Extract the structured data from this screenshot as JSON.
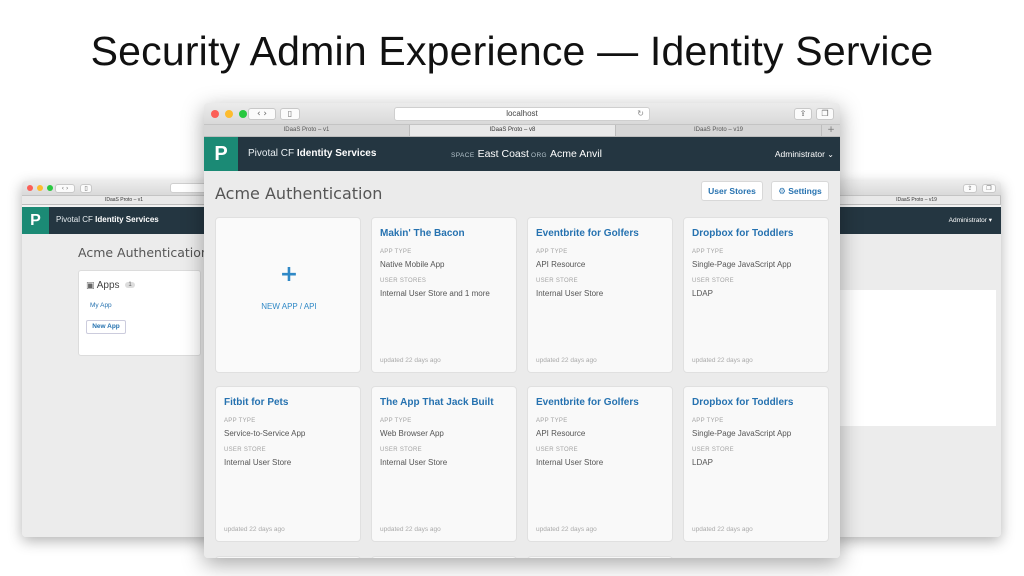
{
  "slide": {
    "title": "Security Admin Experience — Identity Service"
  },
  "browser": {
    "url": "localhost",
    "tabs": [
      "IDaaS Proto – v1",
      "IDaaS Proto – v8",
      "IDaaS Proto – v19"
    ]
  },
  "app": {
    "logo": "P",
    "brand_prefix": "Pivotal CF",
    "brand_name": "Identity Services",
    "space_label": "SPACE",
    "space_value": "East Coast",
    "org_label": "ORG",
    "org_value": "Acme Anvil",
    "user_menu": "Administrator"
  },
  "main": {
    "page_title": "Acme Authentication",
    "user_stores_button": "User Stores",
    "settings_button": "Settings",
    "new_app_label": "NEW APP / API",
    "field_labels": {
      "app_type": "APP TYPE",
      "user_stores": "USER STORES",
      "user_store": "USER STORE"
    },
    "cards": [
      {
        "name": "Makin' The Bacon",
        "app_type": "Native Mobile App",
        "store_label": "USER STORES",
        "store": "Internal User Store and 1 more",
        "updated": "updated 22 days ago"
      },
      {
        "name": "Eventbrite for Golfers",
        "app_type": "API Resource",
        "store_label": "USER STORE",
        "store": "Internal User Store",
        "updated": "updated 22 days ago"
      },
      {
        "name": "Dropbox for Toddlers",
        "app_type": "Single-Page JavaScript App",
        "store_label": "USER STORE",
        "store": "LDAP",
        "updated": "updated 22 days ago"
      },
      {
        "name": "Fitbit for Pets",
        "app_type": "Service-to-Service App",
        "store_label": "USER STORE",
        "store": "Internal User Store",
        "updated": "updated 22 days ago"
      },
      {
        "name": "The App That Jack Built",
        "app_type": "Web Browser App",
        "store_label": "USER STORE",
        "store": "Internal User Store",
        "updated": "updated 22 days ago"
      },
      {
        "name": "Eventbrite for Golfers",
        "app_type": "API Resource",
        "store_label": "USER STORE",
        "store": "Internal User Store",
        "updated": "updated 22 days ago"
      },
      {
        "name": "Dropbox for Toddlers",
        "app_type": "Single-Page JavaScript App",
        "store_label": "USER STORE",
        "store": "LDAP",
        "updated": "updated 22 days ago"
      }
    ]
  },
  "left": {
    "page_title": "Acme Authentication",
    "apps_title": "Apps",
    "apps_count": "1",
    "app_link": "My App",
    "new_app_button": "New App"
  },
  "right": {
    "tab_label": "IDaaS Proto – v19",
    "user_menu": "Administrator"
  },
  "icons": {
    "back_forward": "chevron-left-right-icon",
    "sidebar": "sidebar-icon",
    "reload": "reload-icon",
    "share": "share-icon",
    "tabs": "tabs-overview-icon",
    "apps": "box-icon",
    "settings": "gear-icon",
    "dropdown": "chevron-down-icon"
  },
  "colors": {
    "header_bg": "#243641",
    "logo_bg": "#1b8a75",
    "link_blue": "#2672b0",
    "accent_blue": "#2f88c6"
  }
}
